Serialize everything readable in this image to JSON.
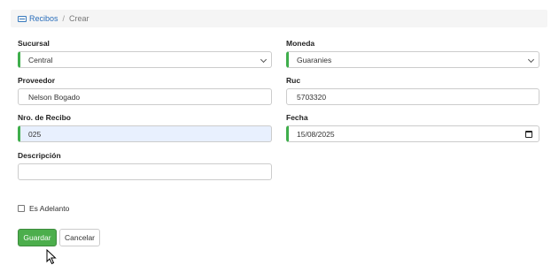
{
  "breadcrumb": {
    "icon": "receipt-icon",
    "link": "Recibos",
    "separator": "/",
    "current": "Crear"
  },
  "form": {
    "sucursal": {
      "label": "Sucursal",
      "value": "Central"
    },
    "moneda": {
      "label": "Moneda",
      "value": "Guaranies"
    },
    "proveedor": {
      "label": "Proveedor",
      "value": "Nelson Bogado"
    },
    "ruc": {
      "label": "Ruc",
      "value": "5703320"
    },
    "nro_recibo": {
      "label": "Nro. de Recibo",
      "value": "025"
    },
    "fecha": {
      "label": "Fecha",
      "value": "15/08/2025"
    },
    "descripcion": {
      "label": "Descripción",
      "value": ""
    },
    "es_adelanto": {
      "label": "Es Adelanto",
      "checked": false
    }
  },
  "actions": {
    "save_label": "Guardar",
    "cancel_label": "Cancelar"
  },
  "colors": {
    "accent_required": "#3fae4c",
    "primary_button": "#4cae4c",
    "focus_bg": "#e8f0fe"
  }
}
